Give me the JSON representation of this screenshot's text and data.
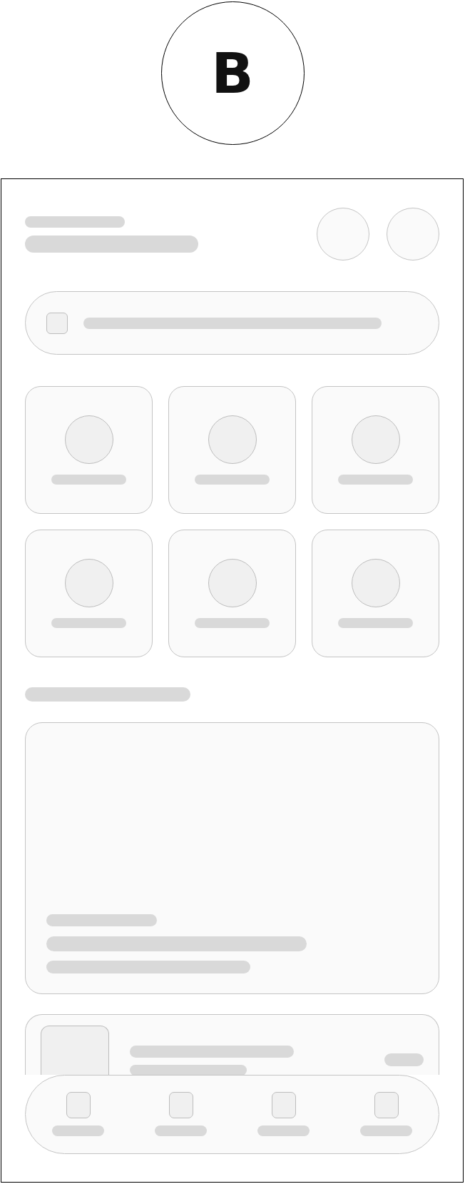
{
  "logo": {
    "letter": "B"
  }
}
